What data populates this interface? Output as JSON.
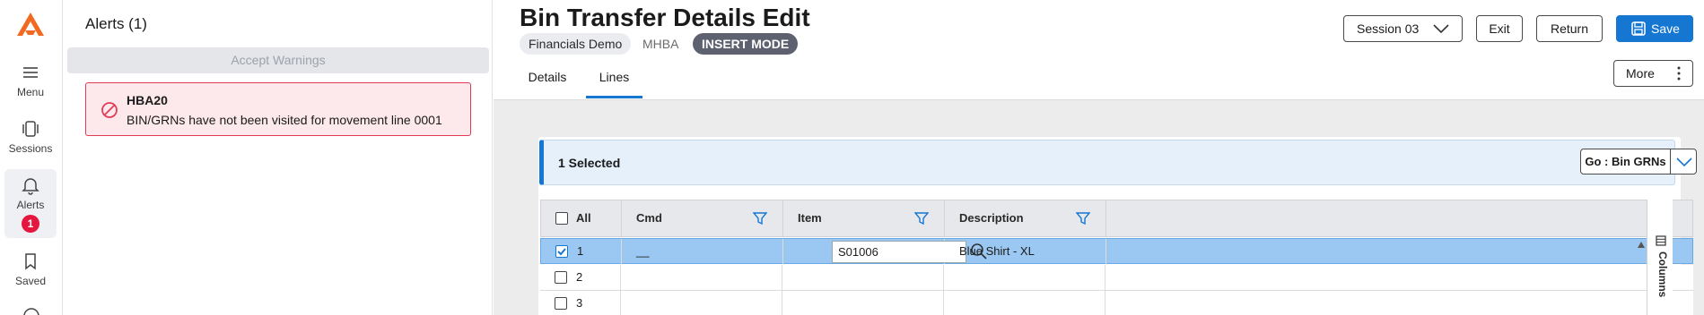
{
  "rail": {
    "items": [
      {
        "label": "Menu",
        "icon": "hamburger-icon"
      },
      {
        "label": "Sessions",
        "icon": "sessions-icon"
      },
      {
        "label": "Alerts",
        "icon": "bell-icon",
        "badge": "1"
      },
      {
        "label": "Saved",
        "icon": "bookmark-icon"
      }
    ]
  },
  "alerts": {
    "title": "Alerts (1)",
    "accept_label": "Accept Warnings",
    "items": [
      {
        "code": "HBA20",
        "message": "BIN/GRNs have not been visited for movement line 0001"
      }
    ]
  },
  "header": {
    "title": "Bin Transfer Details Edit",
    "company": "Financials Demo",
    "code": "MHBA",
    "mode": "INSERT MODE",
    "session_label": "Session 03",
    "exit_label": "Exit",
    "return_label": "Return",
    "save_label": "Save",
    "more_label": "More",
    "tabs": [
      {
        "label": "Details",
        "active": false
      },
      {
        "label": "Lines",
        "active": true
      }
    ]
  },
  "selection": {
    "text": "1 Selected",
    "go_label": "Go : Bin GRNs"
  },
  "grid": {
    "columns": [
      "All",
      "Cmd",
      "Item",
      "Description"
    ],
    "side_label": "Columns",
    "rows": [
      {
        "num": "1",
        "cmd": "__",
        "item": "S01006",
        "description": "Blue Shirt - XL",
        "selected": true
      },
      {
        "num": "2",
        "cmd": "",
        "item": "",
        "description": "",
        "selected": false
      },
      {
        "num": "3",
        "cmd": "",
        "item": "",
        "description": "",
        "selected": false
      }
    ]
  },
  "colors": {
    "accent": "#1677d2",
    "logo": "#f26a21",
    "error": "#e23a55",
    "badge": "#e5173f",
    "mode_chip": "#5d6170",
    "row_selected": "#9ac8f2"
  }
}
